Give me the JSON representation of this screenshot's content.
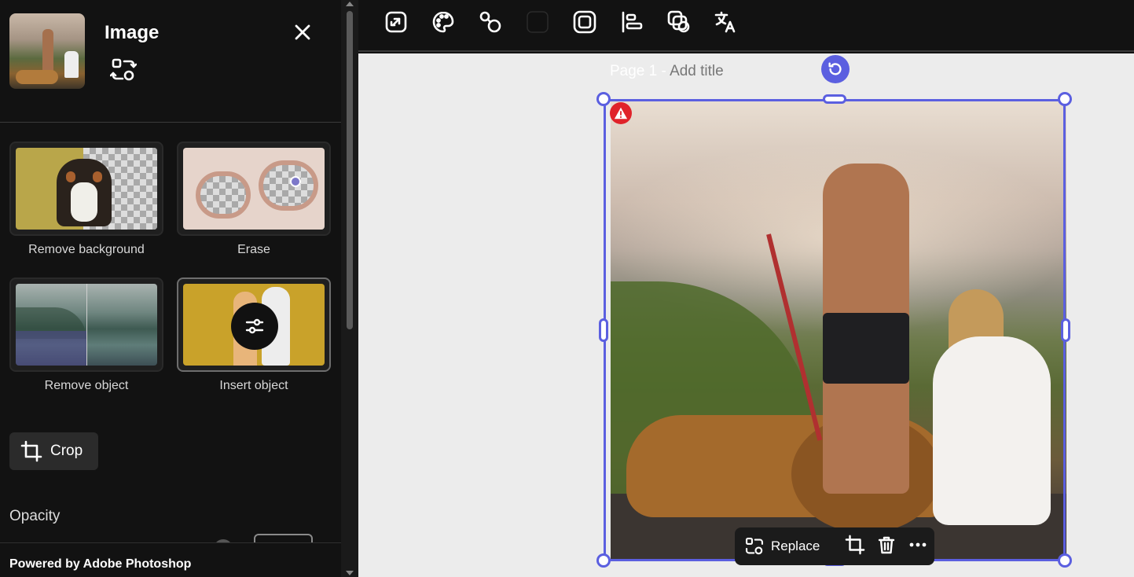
{
  "panel": {
    "title": "Image",
    "tools": [
      {
        "label": "Remove background"
      },
      {
        "label": "Erase"
      },
      {
        "label": "Remove object"
      },
      {
        "label": "Insert object"
      }
    ],
    "crop_label": "Crop",
    "opacity_label": "Opacity",
    "footer": "Powered by Adobe Photoshop"
  },
  "toolbar": {
    "icons": [
      "resize-icon",
      "palette-icon",
      "shapes-icon",
      "color-swatch-icon",
      "frame-icon",
      "align-icon",
      "layers-icon",
      "translate-icon"
    ]
  },
  "canvas": {
    "page_prefix": "Page 1 - ",
    "add_title": "Add title"
  },
  "float_bar": {
    "replace_label": "Replace"
  },
  "colors": {
    "accent": "#5b5fe0",
    "warning": "#e0232a",
    "panel_bg": "#121212"
  }
}
